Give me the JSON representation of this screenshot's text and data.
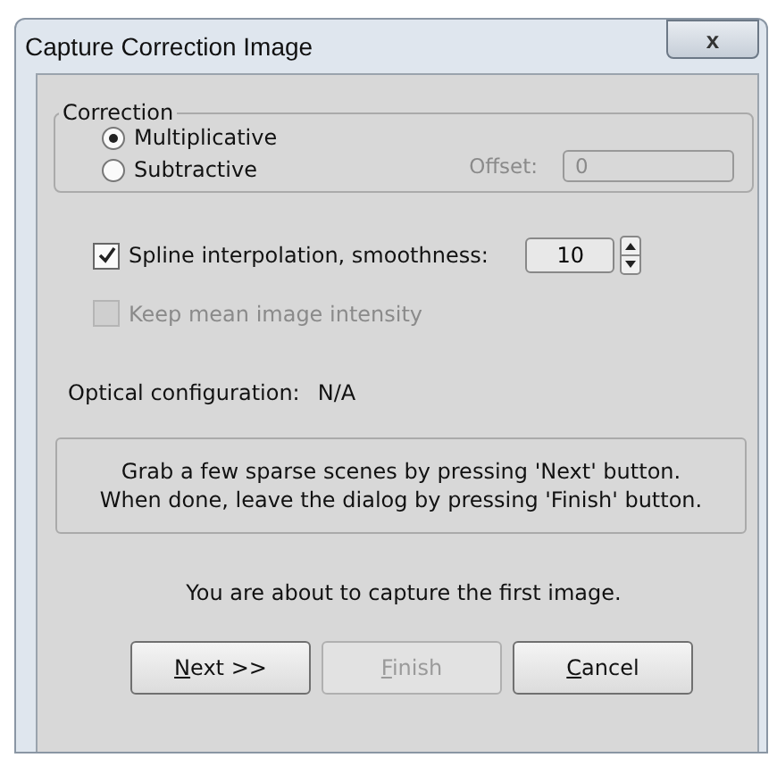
{
  "window": {
    "title": "Capture Correction Image",
    "close": "x"
  },
  "correction": {
    "title": "Correction",
    "options": [
      {
        "label": "Multiplicative",
        "selected": true
      },
      {
        "label": "Subtractive",
        "selected": false
      }
    ],
    "offset": {
      "label": "Offset:",
      "value": "0",
      "disabled": true
    }
  },
  "spline": {
    "label": "Spline interpolation, smoothness:",
    "checked": true,
    "value": "10"
  },
  "keep_mean": {
    "label": "Keep mean image intensity",
    "checked": false,
    "disabled": true
  },
  "optical": {
    "label": "Optical configuration:",
    "value": "N/A"
  },
  "info": [
    "Grab a few sparse scenes by pressing 'Next' button.",
    "When done, leave the dialog by pressing 'Finish' button."
  ],
  "status": "You are about to capture the first image.",
  "buttons": [
    {
      "label": "Next >>",
      "disabled": false
    },
    {
      "label": "Finish",
      "disabled": true
    },
    {
      "label": "Cancel",
      "disabled": false
    }
  ]
}
